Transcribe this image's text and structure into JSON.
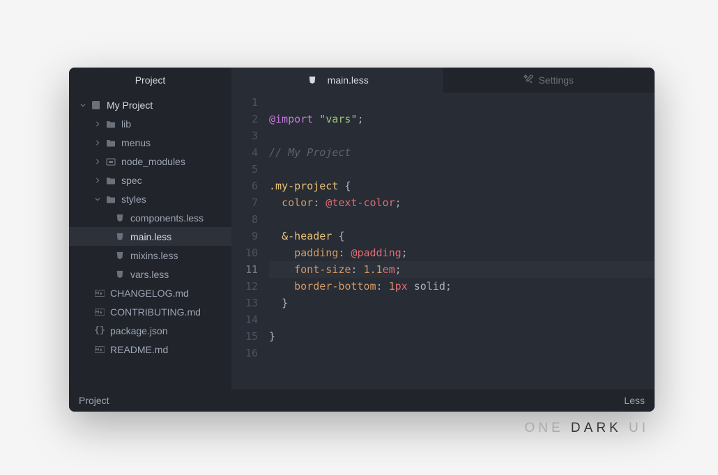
{
  "sidebar": {
    "header": "Project",
    "root": "My Project",
    "folders": [
      "lib",
      "menus",
      "node_modules",
      "spec",
      "styles"
    ],
    "styles_files": [
      "components.less",
      "main.less",
      "mixins.less",
      "vars.less"
    ],
    "root_files": [
      "CHANGELOG.md",
      "CONTRIBUTING.md",
      "package.json",
      "README.md"
    ]
  },
  "tabs": {
    "active": "main.less",
    "settings": "Settings"
  },
  "editor": {
    "cursor_line": 11,
    "lines": {
      "2": {
        "import_kw": "@import",
        "str": "\"vars\"",
        "punc": ";"
      },
      "4": {
        "comment": "// My Project"
      },
      "6": {
        "selector": ".my-project",
        "brace": " {"
      },
      "7": {
        "indent": "  ",
        "prop": "color",
        "colon": ": ",
        "var_at": "@",
        "var_name": "text-color",
        "punc": ";"
      },
      "9": {
        "indent": "  ",
        "amp": "&",
        "sel": "-header",
        "brace": " {"
      },
      "10": {
        "indent": "    ",
        "prop": "padding",
        "colon": ": ",
        "var_at": "@",
        "var_name": "padding",
        "punc": ";"
      },
      "11": {
        "indent": "    ",
        "prop": "font-size",
        "colon": ": ",
        "num": "1.1",
        "unit": "em",
        "punc": ";"
      },
      "12": {
        "indent": "    ",
        "prop": "border-bottom",
        "colon": ": ",
        "num": "1",
        "unit": "px",
        "val2": " solid",
        "punc": ";"
      },
      "13": {
        "indent": "  ",
        "brace": "}"
      },
      "15": {
        "brace": "}"
      }
    }
  },
  "status": {
    "left": "Project",
    "right": "Less"
  },
  "branding": {
    "one": "ONE ",
    "dark": "DARK",
    "ui": " UI"
  }
}
